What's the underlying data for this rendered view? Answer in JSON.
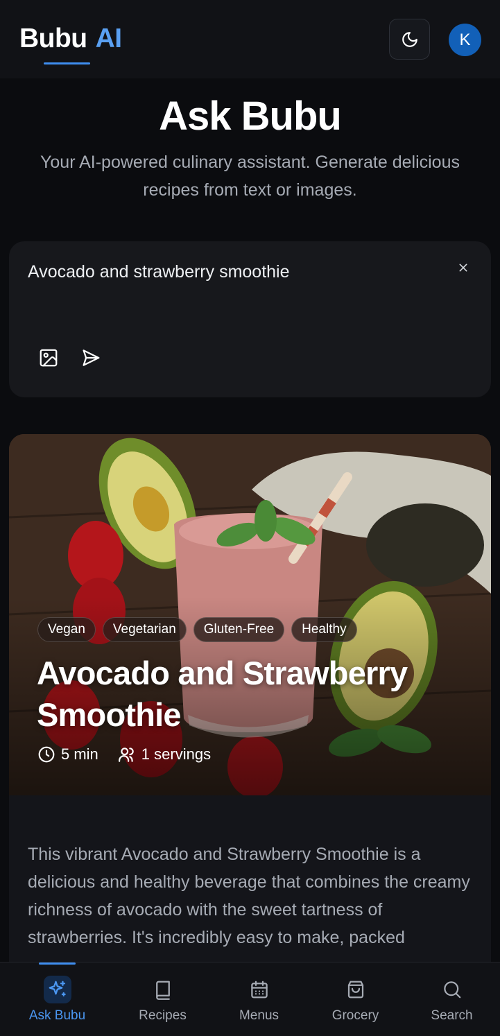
{
  "app": {
    "brand_part1": "Bubu",
    "brand_part2": "AI",
    "avatar_initial": "K",
    "accent_color": "#3f8ef0"
  },
  "hero": {
    "title": "Ask Bubu",
    "subtitle": "Your AI-powered culinary assistant. Generate delicious recipes from text or images."
  },
  "prompt": {
    "value": "Avocado and strawberry smoothie",
    "icons": [
      "close-icon",
      "image-icon",
      "send-icon"
    ]
  },
  "recipe": {
    "tags": [
      "Vegan",
      "Vegetarian",
      "Gluten-Free",
      "Healthy"
    ],
    "title": "Avocado and Strawberry Smoothie",
    "time": "5 min",
    "servings": "1 servings",
    "description": "This vibrant Avocado and Strawberry Smoothie is a delicious and healthy beverage that combines the creamy richness of avocado with the sweet tartness of strawberries. It's incredibly easy to make, packed"
  },
  "bottom_nav": {
    "items": [
      {
        "label": "Ask Bubu",
        "icon": "sparkles-icon",
        "active": true
      },
      {
        "label": "Recipes",
        "icon": "book-icon",
        "active": false
      },
      {
        "label": "Menus",
        "icon": "calendar-icon",
        "active": false
      },
      {
        "label": "Grocery",
        "icon": "shopping-bag-icon",
        "active": false
      },
      {
        "label": "Search",
        "icon": "search-icon",
        "active": false
      }
    ]
  }
}
